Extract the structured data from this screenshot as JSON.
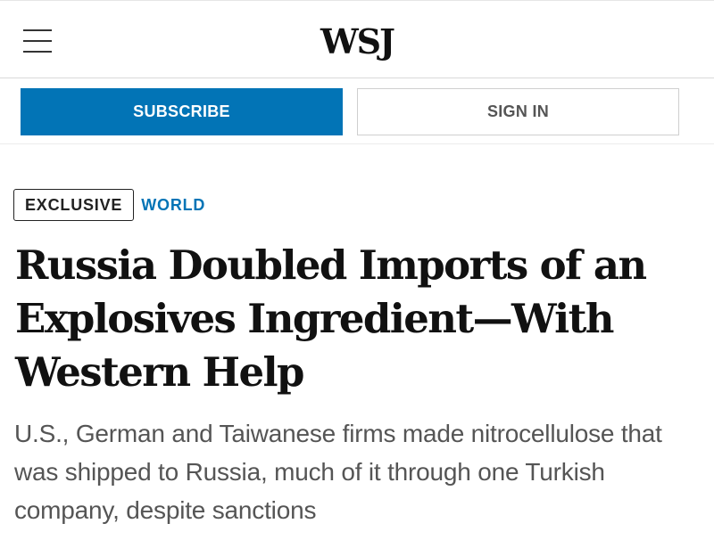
{
  "header": {
    "logo": "WSJ",
    "menu_icon": "hamburger-menu-icon"
  },
  "auth": {
    "subscribe_label": "SUBSCRIBE",
    "signin_label": "SIGN IN",
    "subscribe_color": "#0274b6"
  },
  "article": {
    "flag": "EXCLUSIVE",
    "section": "WORLD",
    "section_color": "#0274b6",
    "headline": "Russia Doubled Imports of an Explosives Ingredient—With Western Help",
    "dek": "U.S., German and Taiwanese firms made nitrocellulose that was shipped to Russia, much of it through one Turkish company, despite sanctions"
  }
}
